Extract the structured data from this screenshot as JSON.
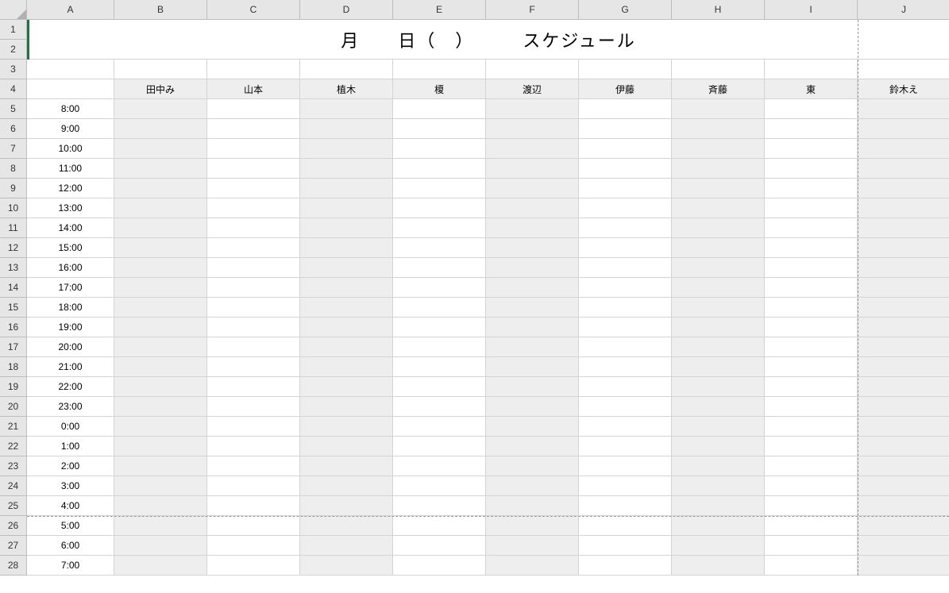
{
  "columns": [
    "A",
    "B",
    "C",
    "D",
    "E",
    "F",
    "G",
    "H",
    "I",
    "J"
  ],
  "row_numbers": [
    1,
    2,
    3,
    4,
    5,
    6,
    7,
    8,
    9,
    10,
    11,
    12,
    13,
    14,
    15,
    16,
    17,
    18,
    19,
    20,
    21,
    22,
    23,
    24,
    25,
    26,
    27,
    28
  ],
  "title": "月　　日（　）　　　スケジュール",
  "headers": [
    "田中み",
    "山本",
    "植木",
    "榎",
    "渡辺",
    "伊藤",
    "斉藤",
    "東",
    "鈴木え"
  ],
  "times": [
    "8:00",
    "9:00",
    "10:00",
    "11:00",
    "12:00",
    "13:00",
    "14:00",
    "15:00",
    "16:00",
    "17:00",
    "18:00",
    "19:00",
    "20:00",
    "21:00",
    "22:00",
    "23:00",
    "0:00",
    "1:00",
    "2:00",
    "3:00",
    "4:00",
    "5:00",
    "6:00",
    "7:00"
  ],
  "shaded_person_cols": [
    0,
    2,
    4,
    6,
    8
  ],
  "selected_cell": "A1",
  "page_break_after_row": 25,
  "page_break_after_col": "I"
}
